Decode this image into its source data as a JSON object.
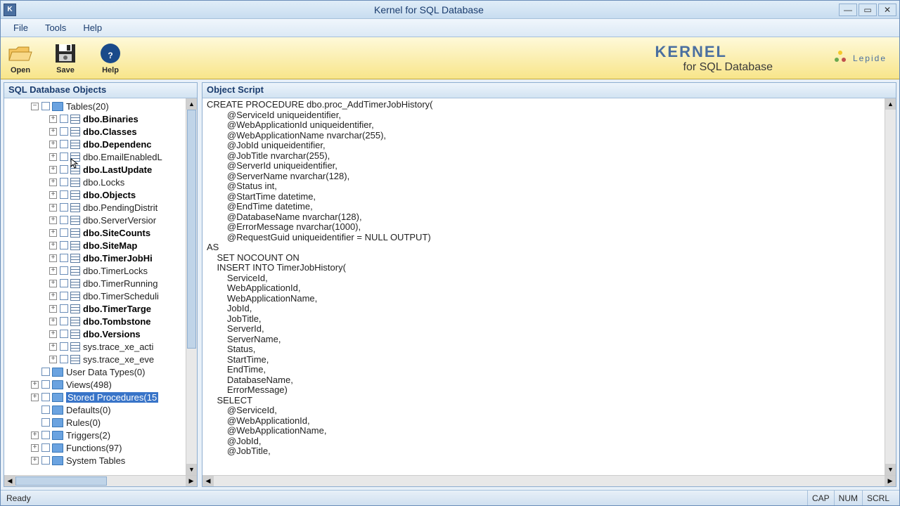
{
  "window": {
    "title": "Kernel for SQL Database",
    "app_letter": "K"
  },
  "menu": {
    "file": "File",
    "tools": "Tools",
    "help": "Help"
  },
  "toolbar": {
    "open": "Open",
    "save": "Save",
    "help": "Help"
  },
  "brand": {
    "line1": "KERNEL",
    "line2": "for SQL Database",
    "company": "Lepide"
  },
  "left_panel": {
    "title": "SQL Database Objects"
  },
  "right_panel": {
    "title": "Object Script"
  },
  "tree": {
    "root": "Tables(20)",
    "tables": [
      {
        "label": "dbo.Binaries",
        "bold": true
      },
      {
        "label": "dbo.Classes",
        "bold": true
      },
      {
        "label": "dbo.Dependenc",
        "bold": true
      },
      {
        "label": "dbo.EmailEnabledL",
        "bold": false,
        "cursor": true
      },
      {
        "label": "dbo.LastUpdate",
        "bold": true
      },
      {
        "label": "dbo.Locks",
        "bold": false
      },
      {
        "label": "dbo.Objects",
        "bold": true
      },
      {
        "label": "dbo.PendingDistrit",
        "bold": false
      },
      {
        "label": "dbo.ServerVersior",
        "bold": false
      },
      {
        "label": "dbo.SiteCounts",
        "bold": true
      },
      {
        "label": "dbo.SiteMap",
        "bold": true
      },
      {
        "label": "dbo.TimerJobHi",
        "bold": true
      },
      {
        "label": "dbo.TimerLocks",
        "bold": false
      },
      {
        "label": "dbo.TimerRunning",
        "bold": false
      },
      {
        "label": "dbo.TimerScheduli",
        "bold": false
      },
      {
        "label": "dbo.TimerTarge",
        "bold": true
      },
      {
        "label": "dbo.Tombstone",
        "bold": true
      },
      {
        "label": "dbo.Versions",
        "bold": true
      },
      {
        "label": "sys.trace_xe_acti",
        "bold": false
      },
      {
        "label": "sys.trace_xe_eve",
        "bold": false
      }
    ],
    "siblings": [
      {
        "label": "User Data Types(0)",
        "expander": "none"
      },
      {
        "label": "Views(498)",
        "expander": "plus"
      },
      {
        "label": "Stored Procedures(15",
        "expander": "plus",
        "selected": true
      },
      {
        "label": "Defaults(0)",
        "expander": "none"
      },
      {
        "label": "Rules(0)",
        "expander": "none"
      },
      {
        "label": "Triggers(2)",
        "expander": "plus"
      },
      {
        "label": "Functions(97)",
        "expander": "plus"
      },
      {
        "label": "System Tables",
        "expander": "plus"
      }
    ]
  },
  "script": "CREATE PROCEDURE dbo.proc_AddTimerJobHistory(\n        @ServiceId uniqueidentifier,\n        @WebApplicationId uniqueidentifier,\n        @WebApplicationName nvarchar(255),\n        @JobId uniqueidentifier,\n        @JobTitle nvarchar(255),\n        @ServerId uniqueidentifier,\n        @ServerName nvarchar(128),\n        @Status int,\n        @StartTime datetime,\n        @EndTime datetime,\n        @DatabaseName nvarchar(128),\n        @ErrorMessage nvarchar(1000),\n        @RequestGuid uniqueidentifier = NULL OUTPUT)\nAS\n    SET NOCOUNT ON\n    INSERT INTO TimerJobHistory(\n        ServiceId,\n        WebApplicationId,\n        WebApplicationName,\n        JobId,\n        JobTitle,\n        ServerId,\n        ServerName,\n        Status,\n        StartTime,\n        EndTime,\n        DatabaseName,\n        ErrorMessage)\n    SELECT\n        @ServiceId,\n        @WebApplicationId,\n        @WebApplicationName,\n        @JobId,\n        @JobTitle,",
  "status": {
    "ready": "Ready",
    "cap": "CAP",
    "num": "NUM",
    "scrl": "SCRL"
  }
}
